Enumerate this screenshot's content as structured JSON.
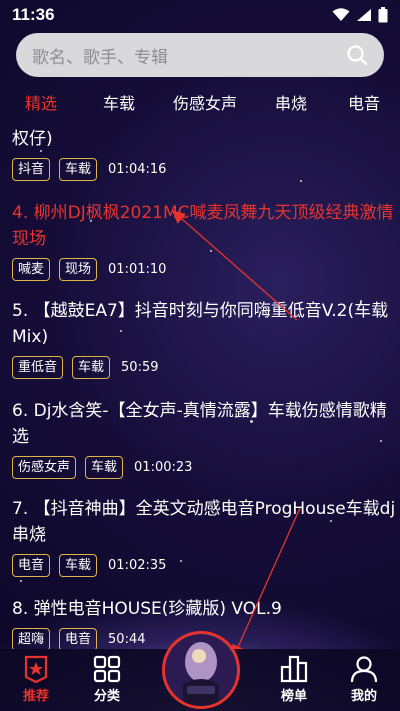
{
  "status_bar": {
    "time": "11:36"
  },
  "search": {
    "placeholder": "歌名、歌手、专辑"
  },
  "tabs": [
    {
      "label": "精选",
      "active": true
    },
    {
      "label": "车载",
      "active": false
    },
    {
      "label": "伤感女声",
      "active": false
    },
    {
      "label": "串烧",
      "active": false
    },
    {
      "label": "电音",
      "active": false
    }
  ],
  "songs": [
    {
      "title": "权仔)",
      "tags": [
        "抖音",
        "车载"
      ],
      "duration": "01:04:16",
      "highlighted": false
    },
    {
      "title": "4. 柳州DJ枫枫2021MC喊麦凤舞九天顶级经典激情现场",
      "tags": [
        "喊麦",
        "现场"
      ],
      "duration": "01:01:10",
      "highlighted": true
    },
    {
      "title": "5. 【越鼓EA7】抖音时刻与你同嗨重低音V.2(车载Mix)",
      "tags": [
        "重低音",
        "车载"
      ],
      "duration": "50:59",
      "highlighted": false
    },
    {
      "title": "6. Dj水含笑-【全女声-真情流露】车载伤感情歌精选",
      "tags": [
        "伤感女声",
        "车载"
      ],
      "duration": "01:00:23",
      "highlighted": false
    },
    {
      "title": "7. 【抖音神曲】全英文动感电音ProgHouse车载dj串烧",
      "tags": [
        "电音",
        "车载"
      ],
      "duration": "01:02:35",
      "highlighted": false
    },
    {
      "title": "8. 弹性电音HOUSE(珍藏版) VOL.9",
      "tags": [
        "超嗨",
        "电音"
      ],
      "duration": "50:44",
      "highlighted": false
    }
  ],
  "bottom_nav": [
    {
      "label": "推荐",
      "icon": "star-badge-icon",
      "active": true
    },
    {
      "label": "分类",
      "icon": "grid-icon",
      "active": false
    },
    {
      "label": "榜单",
      "icon": "bar-chart-icon",
      "active": false
    },
    {
      "label": "我的",
      "icon": "person-icon",
      "active": false
    }
  ],
  "colors": {
    "accent": "#e8332c",
    "tag_border": "#e0b44a",
    "search_bg": "#d9d9dc"
  }
}
